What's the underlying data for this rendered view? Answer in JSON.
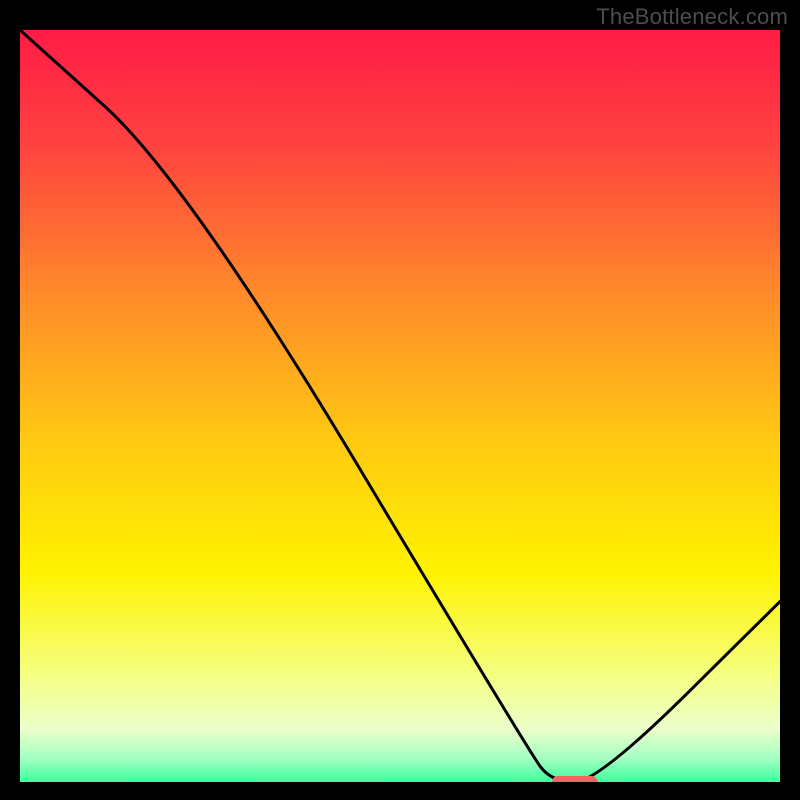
{
  "watermark": "TheBottleneck.com",
  "chart_data": {
    "type": "line",
    "title": "",
    "xlabel": "",
    "ylabel": "",
    "xlim": [
      0,
      100
    ],
    "ylim": [
      0,
      100
    ],
    "grid": false,
    "series": [
      {
        "name": "curve",
        "x": [
          0,
          22,
          67,
          70,
          76,
          100
        ],
        "values": [
          100,
          80,
          4,
          0,
          0,
          24
        ]
      }
    ],
    "marker": {
      "x_start": 70,
      "x_end": 76,
      "y": 0,
      "color": "#e66a61"
    },
    "gradient_stops": [
      {
        "offset": 0.0,
        "color": "#ff1c46"
      },
      {
        "offset": 0.15,
        "color": "#ff4140"
      },
      {
        "offset": 0.35,
        "color": "#ff8a2a"
      },
      {
        "offset": 0.55,
        "color": "#ffca12"
      },
      {
        "offset": 0.72,
        "color": "#fff200"
      },
      {
        "offset": 0.85,
        "color": "#f6ff7a"
      },
      {
        "offset": 0.93,
        "color": "#ecffcb"
      },
      {
        "offset": 0.97,
        "color": "#9fffc2"
      },
      {
        "offset": 1.0,
        "color": "#3cff9a"
      }
    ]
  }
}
